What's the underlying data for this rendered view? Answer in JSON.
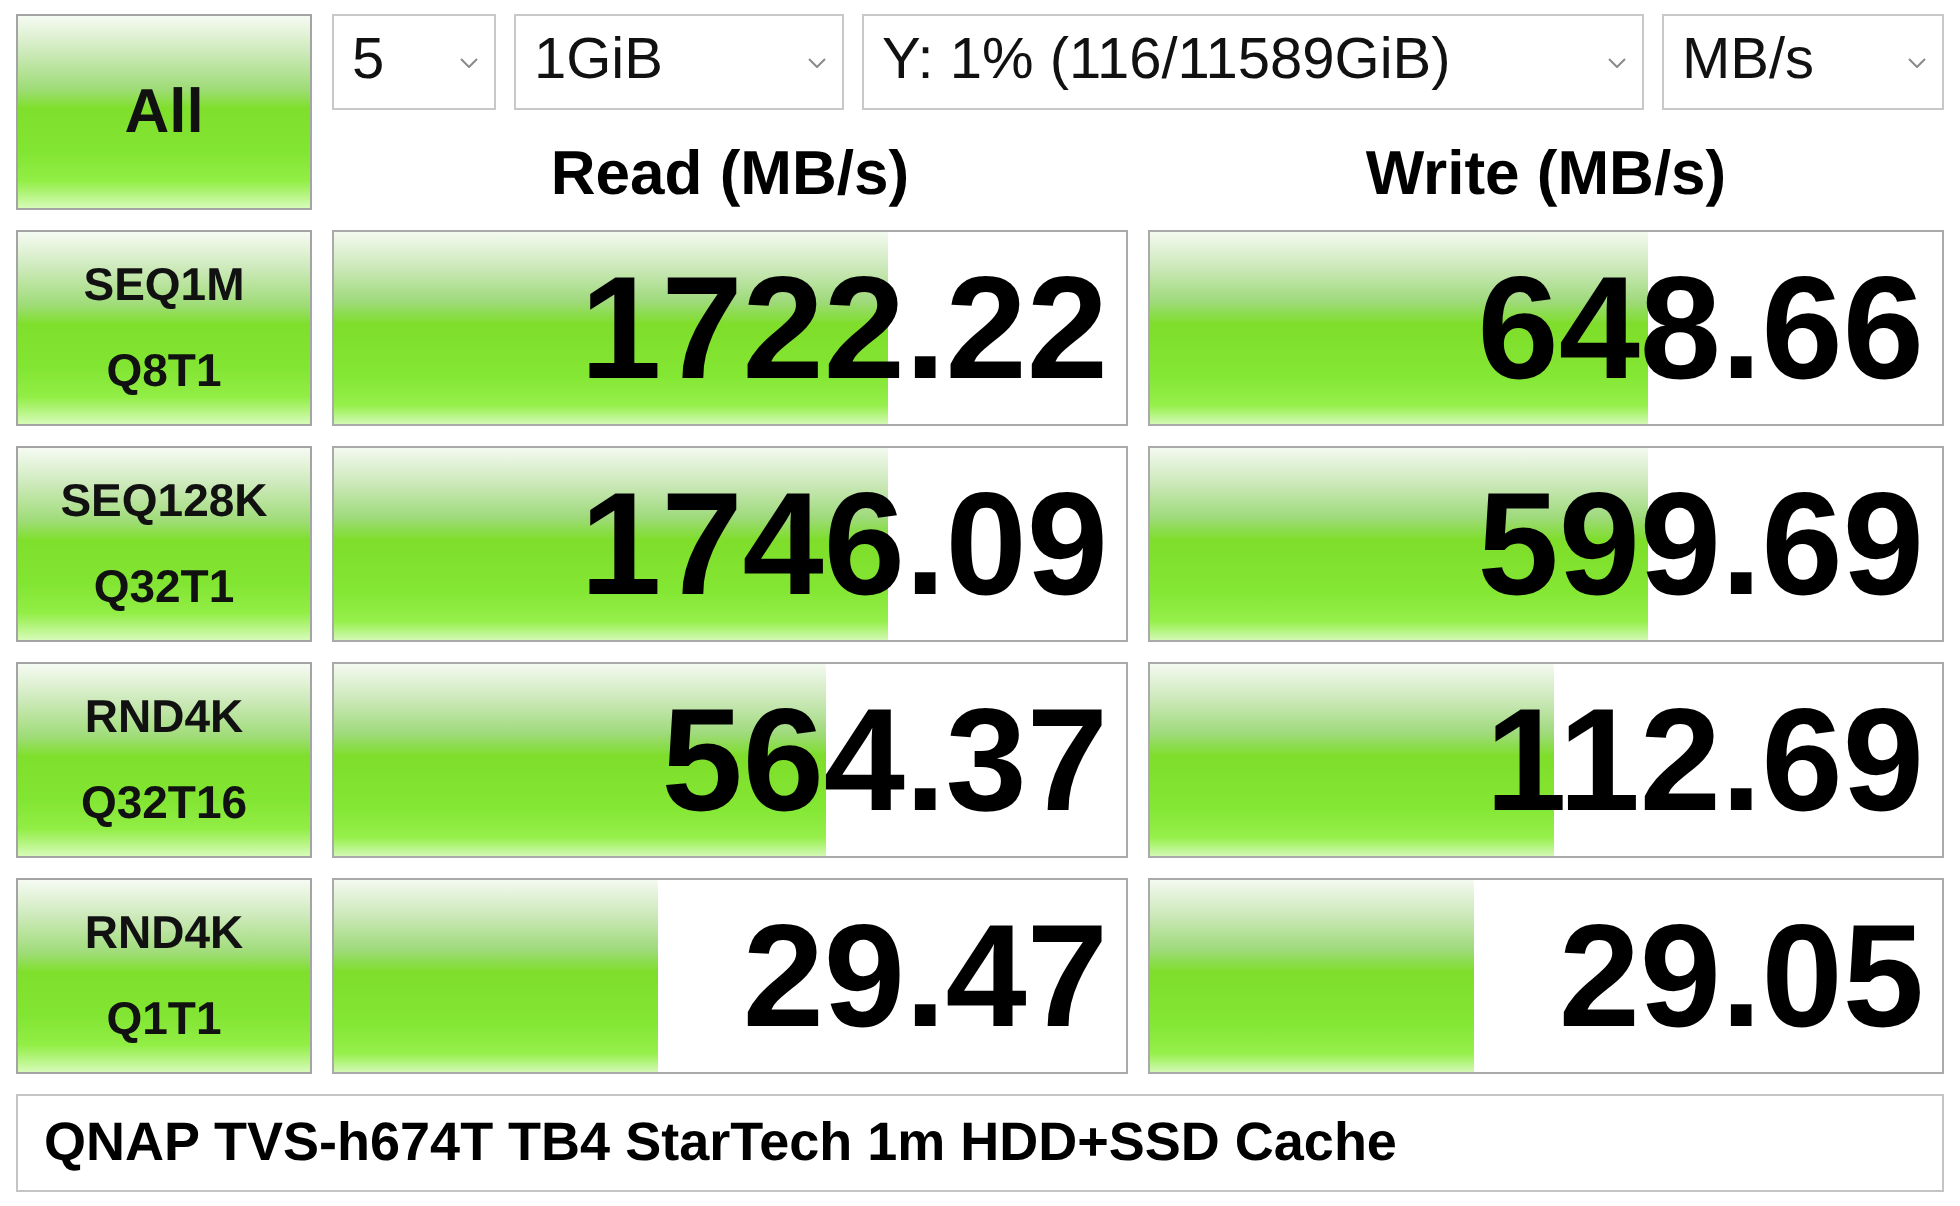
{
  "toolbar": {
    "all_button": "All",
    "dropdowns": [
      {
        "kind": "count",
        "value": "5"
      },
      {
        "kind": "size",
        "value": "1GiB"
      },
      {
        "kind": "drive",
        "value": "Y: 1% (116/11589GiB)"
      },
      {
        "kind": "unit",
        "value": "MB/s"
      }
    ]
  },
  "columns": [
    "Read (MB/s)",
    "Write (MB/s)"
  ],
  "tests": [
    {
      "name": "SEQ1M",
      "params": "Q8T1",
      "read": {
        "value": "1722.22",
        "level": 0.7
      },
      "write": {
        "value": "648.66",
        "level": 0.63
      }
    },
    {
      "name": "SEQ128K",
      "params": "Q32T1",
      "read": {
        "value": "1746.09",
        "level": 0.7
      },
      "write": {
        "value": "599.69",
        "level": 0.63
      }
    },
    {
      "name": "RND4K",
      "params": "Q32T16",
      "read": {
        "value": "564.37",
        "level": 0.62
      },
      "write": {
        "value": "112.69",
        "level": 0.51
      }
    },
    {
      "name": "RND4K",
      "params": "Q1T1",
      "read": {
        "value": "29.47",
        "level": 0.41
      },
      "write": {
        "value": "29.05",
        "level": 0.41
      }
    }
  ],
  "comment": "QNAP TVS-h674T TB4 StarTech 1m HDD+SSD Cache"
}
